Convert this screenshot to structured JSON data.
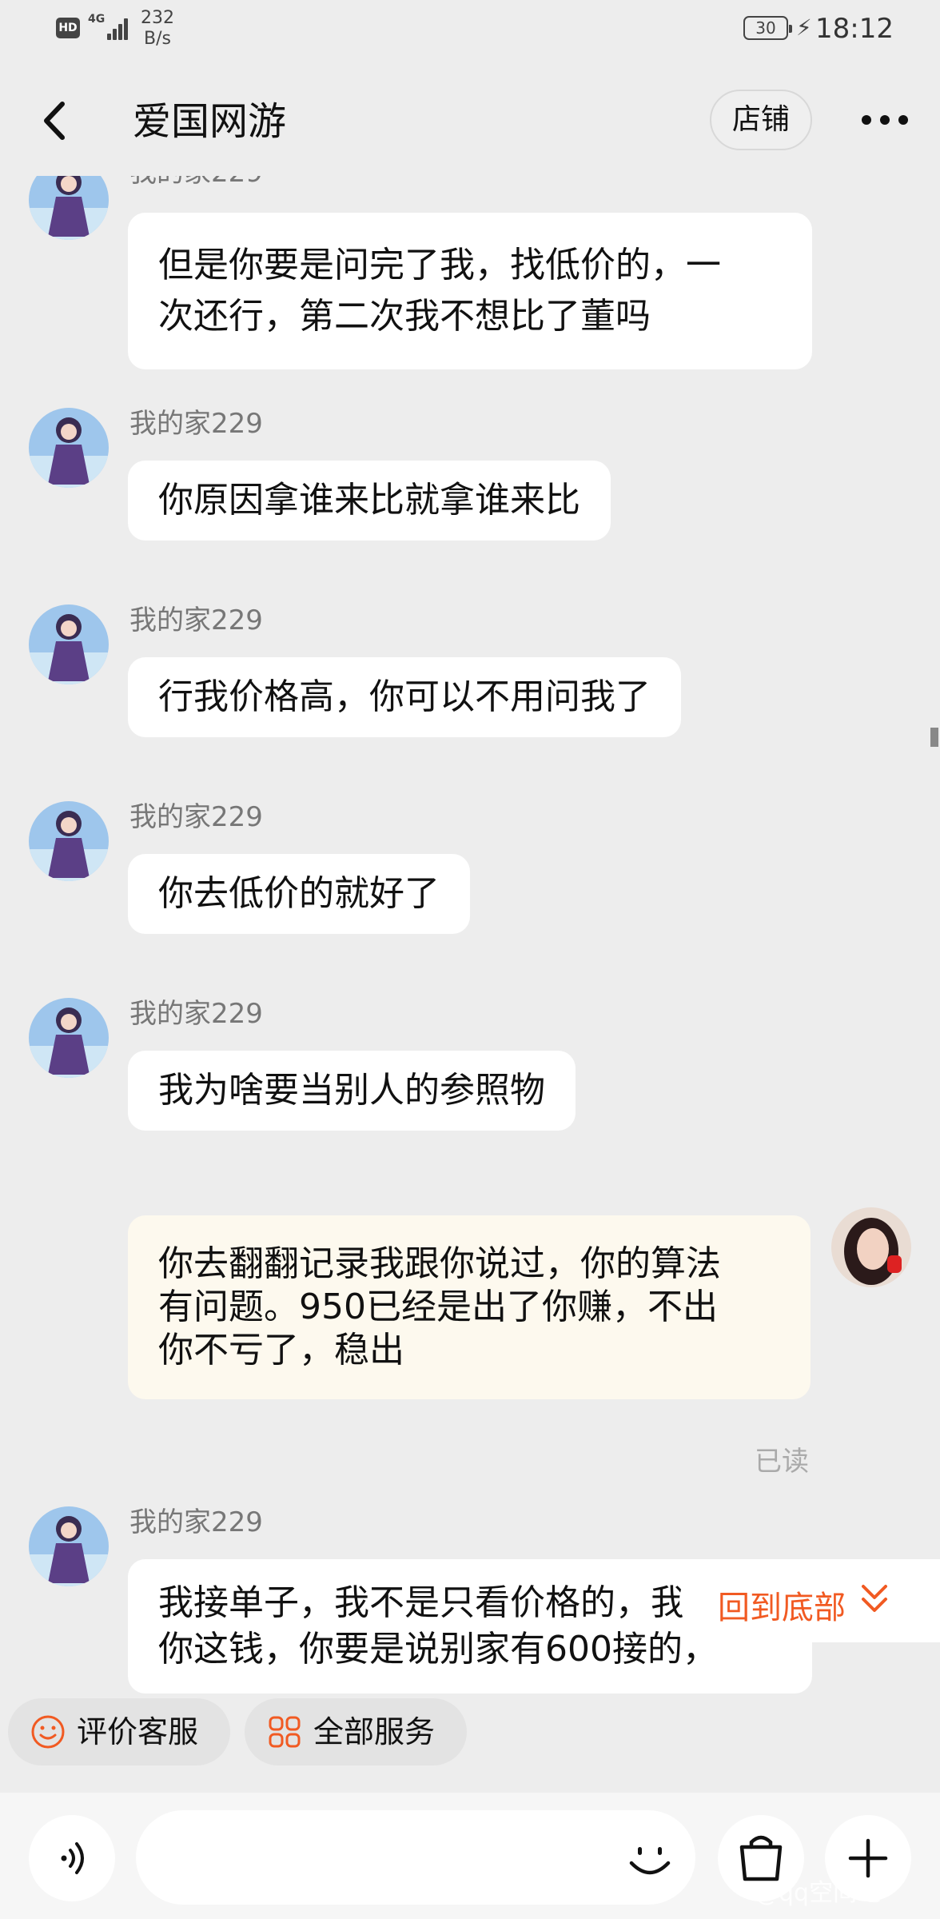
{
  "status_bar": {
    "hd": "HD",
    "network": "4G",
    "speed_value": "232",
    "speed_unit": "B/s",
    "battery": "30",
    "time": "18:12"
  },
  "header": {
    "title": "爱国网游",
    "store_label": "店铺"
  },
  "messages": [
    {
      "sender": "我的家229",
      "text": "但是你要是问完了我，找低价的，一次还行，第二次我不想比了董吗",
      "lines": [
        "但是你要是问完了我，找低价的，一",
        "次还行，第二次我不想比了董吗"
      ]
    },
    {
      "sender": "我的家229",
      "text": "你原因拿谁来比就拿谁来比"
    },
    {
      "sender": "我的家229",
      "text": "行我价格高，你可以不用问我了"
    },
    {
      "sender": "我的家229",
      "text": "你去低价的就好了"
    },
    {
      "sender": "我的家229",
      "text": "我为啥要当别人的参照物"
    },
    {
      "sender": "me",
      "lines": [
        "你去翻翻记录我跟你说过，你的算法",
        "有问题。950已经是出了你赚，不出",
        "你不亏了，稳出"
      ],
      "status": "已读"
    },
    {
      "sender": "我的家229",
      "lines": [
        "我接单子，我不是只看价格的，我要",
        "你这钱，你要是说别家有600接的，"
      ]
    }
  ],
  "back_to_bottom_label": "回到底部",
  "quick_services": [
    {
      "label": "评价客服",
      "icon": "smiley-icon"
    },
    {
      "label": "全部服务",
      "icon": "grid-icon"
    }
  ],
  "watermark": "@qq空间吧",
  "colors": {
    "accent": "#f15a22",
    "background": "#ededed",
    "bubble_other": "#ffffff",
    "bubble_me": "#fdf9ee"
  }
}
